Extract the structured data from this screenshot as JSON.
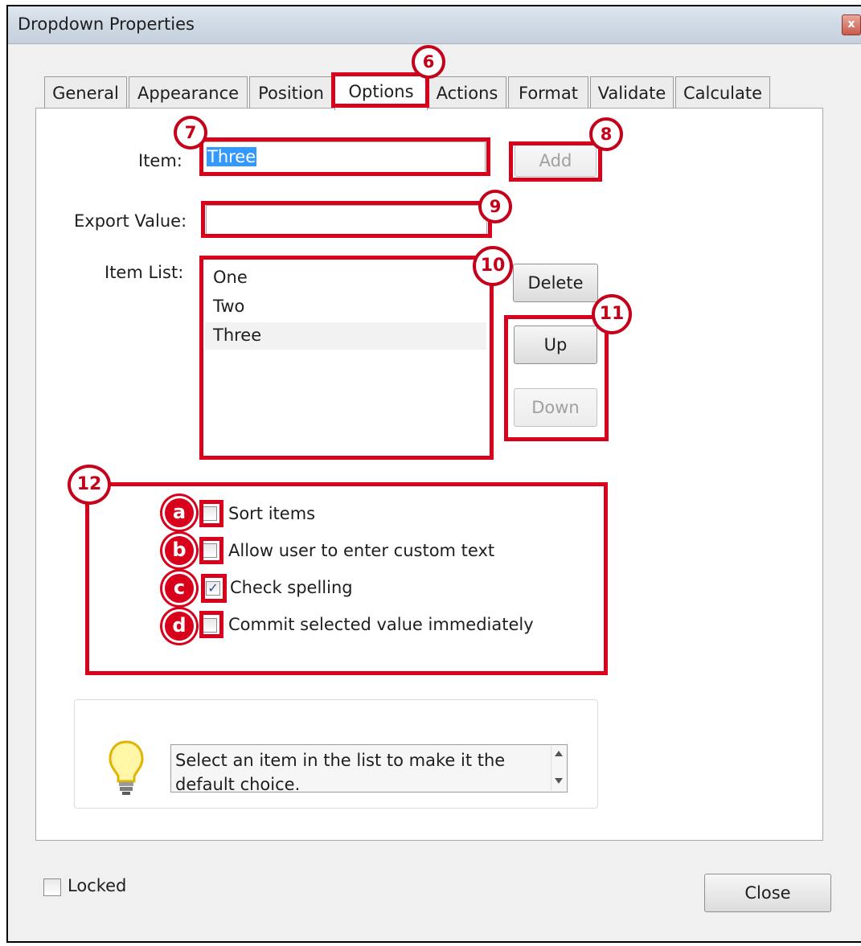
{
  "window": {
    "title": "Dropdown Properties",
    "close_glyph": "x"
  },
  "tabs": [
    {
      "label": "General"
    },
    {
      "label": "Appearance"
    },
    {
      "label": "Position"
    },
    {
      "label": "Options",
      "active": true
    },
    {
      "label": "Actions"
    },
    {
      "label": "Format"
    },
    {
      "label": "Validate"
    },
    {
      "label": "Calculate"
    }
  ],
  "options": {
    "item_label": "Item:",
    "item_value": "Three",
    "add_button": "Add",
    "export_value_label": "Export Value:",
    "export_value": "",
    "item_list_label": "Item List:",
    "item_list": [
      "One",
      "Two",
      "Three"
    ],
    "selected_item": "Three",
    "delete_button": "Delete",
    "up_button": "Up",
    "down_button": "Down",
    "checkboxes": [
      {
        "label": "Sort items",
        "checked": false
      },
      {
        "label": "Allow user to enter custom text",
        "checked": false
      },
      {
        "label": "Check spelling",
        "checked": true
      },
      {
        "label": "Commit selected value immediately",
        "checked": false
      }
    ],
    "hint_line1": "Select an item in the list to make it the",
    "hint_line2": "default choice."
  },
  "footer": {
    "locked_label": "Locked",
    "locked_checked": false,
    "close_button": "Close"
  },
  "annotations": {
    "numbers": [
      "6",
      "7",
      "8",
      "9",
      "10",
      "11",
      "12"
    ],
    "letters": [
      "a",
      "b",
      "c",
      "d"
    ],
    "color": "#d9001b"
  },
  "icons": {
    "hint": "lightbulb-icon",
    "scroll_up": "scroll-up-arrow-icon",
    "scroll_down": "scroll-down-arrow-icon"
  }
}
